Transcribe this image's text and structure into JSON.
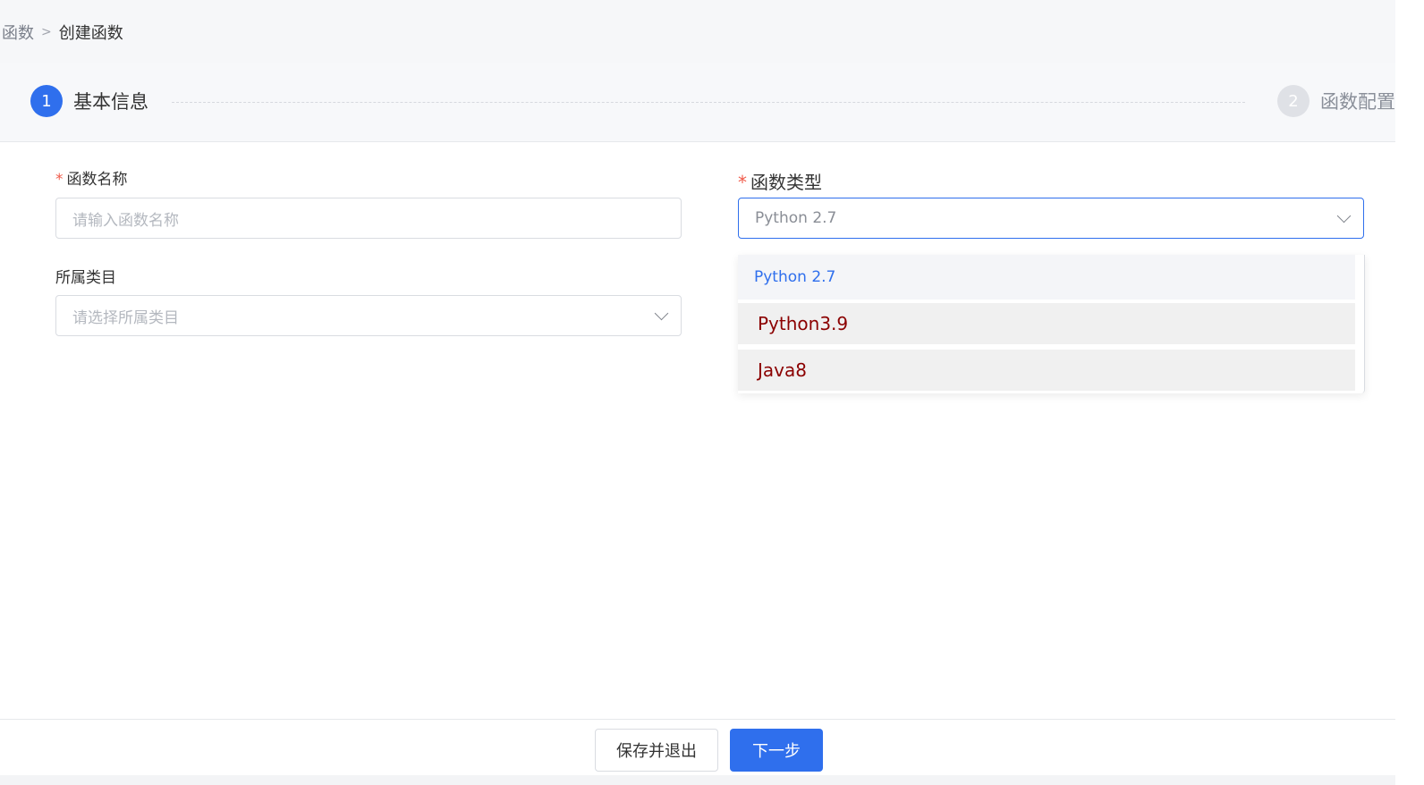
{
  "breadcrumb": {
    "parent": "函数",
    "separator": ">",
    "current": "创建函数"
  },
  "steps": [
    {
      "number": "1",
      "label": "基本信息",
      "status": "active"
    },
    {
      "number": "2",
      "label": "函数配置",
      "status": "pending"
    }
  ],
  "form": {
    "function_name": {
      "label": "函数名称",
      "required_mark": "*",
      "placeholder": "请输入函数名称",
      "value": ""
    },
    "category": {
      "label": "所属类目",
      "placeholder": "请选择所属类目"
    },
    "function_type": {
      "label": "函数类型",
      "required_mark": "*",
      "selected": "Python 2.7",
      "options": [
        "Python 2.7",
        "Python3.9",
        "Java8"
      ]
    }
  },
  "footer": {
    "save_exit_label": "保存并退出",
    "next_label": "下一步"
  },
  "colors": {
    "primary": "#2f6fed",
    "required": "#f05b4b",
    "option_text": "#8b0000"
  }
}
